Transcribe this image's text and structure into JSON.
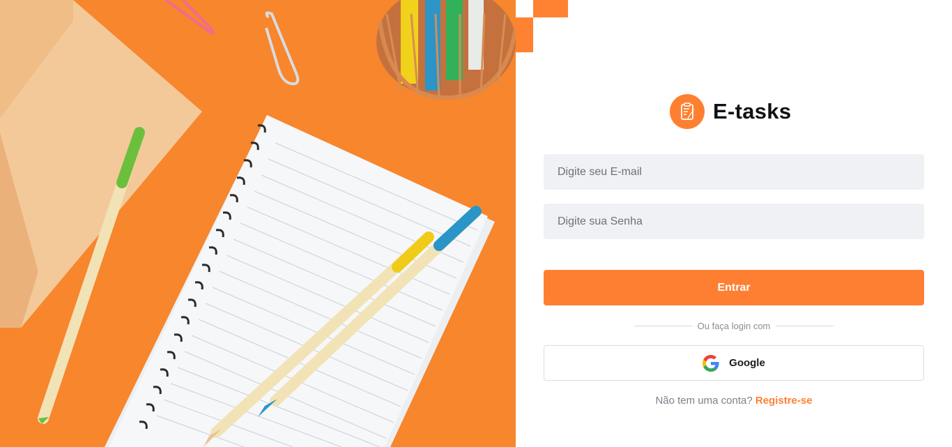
{
  "brand": {
    "name": "E-tasks",
    "logo_icon": "clipboard-pen-icon"
  },
  "form": {
    "email_placeholder": "Digite seu E-mail",
    "password_placeholder": "Digite sua Senha",
    "login_label": "Entrar"
  },
  "divider_text": "Ou faça login com",
  "google": {
    "label": "Google",
    "icon": "google-icon"
  },
  "register": {
    "prompt": "Não tem uma conta?",
    "link_label": "Registre-se"
  },
  "colors": {
    "accent": "#ff7f32",
    "hero_background": "#f7852c",
    "field_background": "#f0f1f4"
  }
}
